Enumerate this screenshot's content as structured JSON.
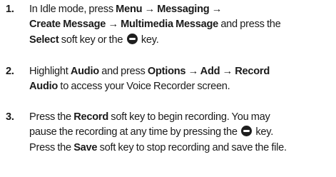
{
  "steps": [
    {
      "number": "1.",
      "lines": [
        [
          {
            "t": "In Idle mode, press "
          },
          {
            "t": "Menu → Messaging →",
            "b": true
          }
        ],
        [
          {
            "t": "Create Message → Multimedia Message",
            "b": true
          },
          {
            "t": " and press the"
          }
        ],
        [
          {
            "t": "Select",
            "b": true
          },
          {
            "t": " soft key or the "
          },
          {
            "icon": "ok-key-icon"
          },
          {
            "t": " key."
          }
        ]
      ]
    },
    {
      "number": "2.",
      "lines": [
        [
          {
            "t": "Highlight "
          },
          {
            "t": "Audio",
            "b": true
          },
          {
            "t": " and press "
          },
          {
            "t": "Options → Add → Record",
            "b": true
          }
        ],
        [
          {
            "t": "Audio",
            "b": true
          },
          {
            "t": " to access your Voice Recorder screen."
          }
        ]
      ]
    },
    {
      "number": "3.",
      "lines": [
        [
          {
            "t": "Press the "
          },
          {
            "t": "Record",
            "b": true
          },
          {
            "t": " soft key to begin recording. You may"
          }
        ],
        [
          {
            "t": "pause the recording at any time by pressing the "
          },
          {
            "icon": "ok-key-icon"
          },
          {
            "t": " key."
          }
        ],
        [
          {
            "t": "Press the "
          },
          {
            "t": "Save",
            "b": true
          },
          {
            "t": " soft key to stop recording and save the file."
          }
        ]
      ]
    }
  ]
}
